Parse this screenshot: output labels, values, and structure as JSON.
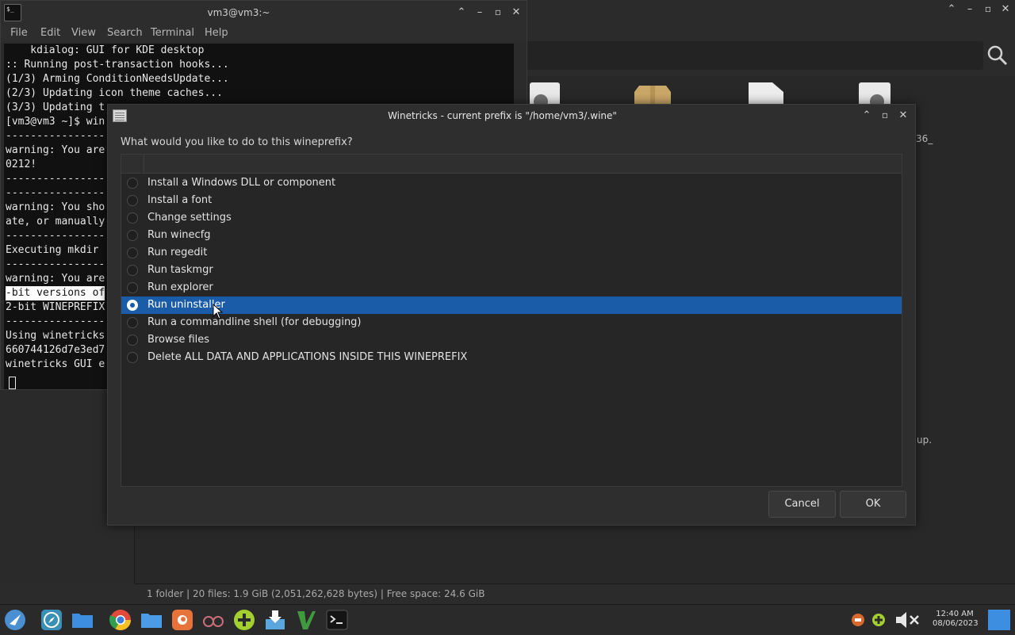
{
  "terminal": {
    "title": "vm3@vm3:~",
    "menu": [
      "File",
      "Edit",
      "View",
      "Search",
      "Terminal",
      "Help"
    ],
    "lines": [
      "    kdialog: GUI for KDE desktop",
      ":: Running post-transaction hooks...",
      "(1/3) Arming ConditionNeedsUpdate...",
      "(2/3) Updating icon theme caches...",
      "(3/3) Updating t",
      "[vm3@vm3 ~]$ win",
      "----------------",
      "warning: You are",
      "0212!",
      "----------------",
      "----------------",
      "warning: You sho",
      "ate, or manually",
      "----------------",
      "Executing mkdir ",
      "----------------",
      "warning: You are",
      "-bit versions of",
      "2-bit WINEPREFIX",
      "----------------",
      "Using winetricks",
      "660744126d7e3ed7",
      "winetricks GUI e"
    ]
  },
  "file_manager": {
    "status": "1 folder  |  20 files: 1.9 GiB (2,051,262,628 bytes)  |  Free space: 24.6 GiB",
    "side_text_1": "36_",
    "side_text_2": "up."
  },
  "dialog": {
    "title": "Winetricks - current prefix is \"/home/vm3/.wine\"",
    "question": "What would you like to do to this wineprefix?",
    "options": [
      "Install a Windows DLL or component",
      "Install a font",
      "Change settings",
      "Run winecfg",
      "Run regedit",
      "Run taskmgr",
      "Run explorer",
      "Run uninstaller",
      "Run a commandline shell (for debugging)",
      "Browse files",
      "Delete ALL DATA AND APPLICATIONS INSIDE THIS WINEPREFIX"
    ],
    "selected_index": 7,
    "cancel_label": "Cancel",
    "ok_label": "OK"
  },
  "taskbar": {
    "time": "12:40 AM",
    "date": "08/06/2023",
    "accent_color": "#1b5ca8"
  }
}
